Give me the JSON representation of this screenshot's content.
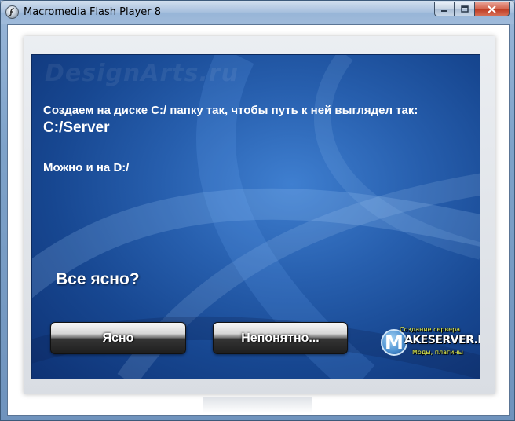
{
  "window": {
    "title": "Macromedia Flash Player 8",
    "icon": "flash-player-icon",
    "controls": [
      "minimize-icon",
      "maximize-icon",
      "close-icon"
    ]
  },
  "content": {
    "watermark": "DesignArts.ru",
    "instruction": "Создаем на диске C:/ папку так, чтобы путь к ней выглядел так:",
    "path": "C:/Server",
    "alternative": "Можно и на D:/",
    "question": "Все ясно?",
    "buttons": {
      "ok_label": "Ясно",
      "unclear_label": "Непонятно..."
    }
  },
  "logo": {
    "letter": "M",
    "top": "Создание сервера",
    "main": "AKESERVER.RU",
    "sub": "Моды, плагины"
  },
  "colors": {
    "panel_blue": "#275fae",
    "logo_accent": "#e9f34a"
  }
}
